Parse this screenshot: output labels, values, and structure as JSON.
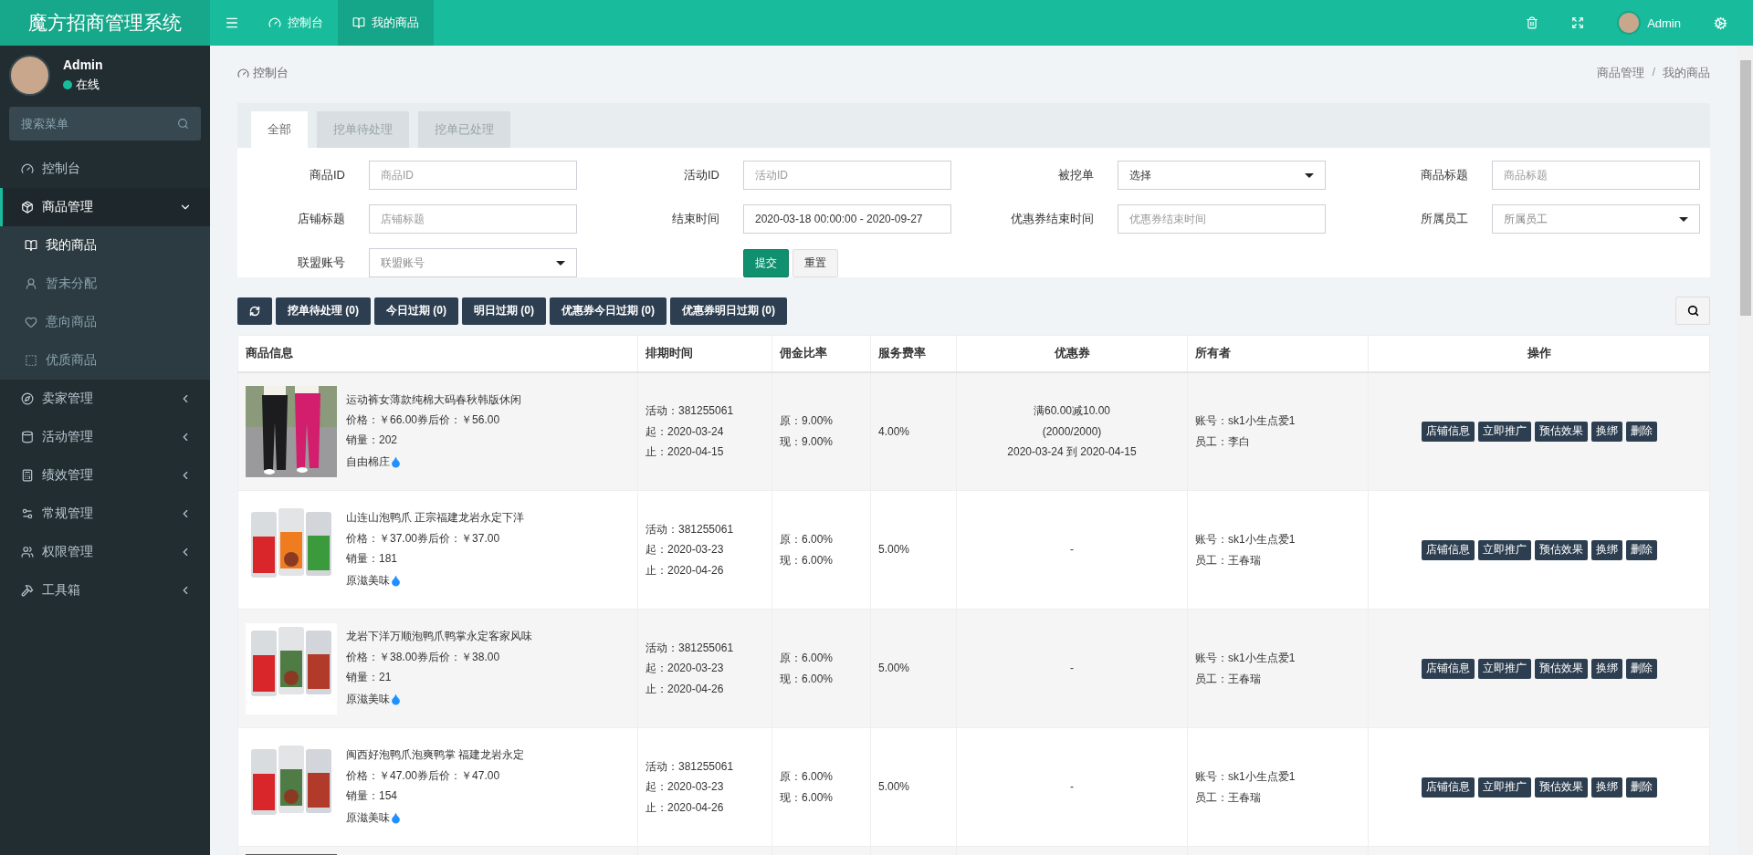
{
  "app": {
    "title": "魔方招商管理系统"
  },
  "topbar": {
    "tabs": [
      {
        "label": "控制台",
        "selected": false
      },
      {
        "label": "我的商品",
        "selected": true
      }
    ],
    "user": "Admin"
  },
  "sidebar": {
    "user": {
      "name": "Admin",
      "status": "在线"
    },
    "search": {
      "placeholder": "搜索菜单"
    },
    "items": [
      {
        "label": "控制台",
        "kind": "link"
      },
      {
        "label": "商品管理",
        "kind": "group",
        "expanded": true,
        "children": [
          {
            "label": "我的商品",
            "selected": true
          },
          {
            "label": "暂未分配",
            "selected": false
          },
          {
            "label": "意向商品",
            "selected": false
          },
          {
            "label": "优质商品",
            "selected": false
          }
        ]
      },
      {
        "label": "卖家管理",
        "kind": "group",
        "expanded": false
      },
      {
        "label": "活动管理",
        "kind": "group",
        "expanded": false
      },
      {
        "label": "绩效管理",
        "kind": "group",
        "expanded": false
      },
      {
        "label": "常规管理",
        "kind": "group",
        "expanded": false
      },
      {
        "label": "权限管理",
        "kind": "group",
        "expanded": false
      },
      {
        "label": "工具箱",
        "kind": "group",
        "expanded": false
      }
    ]
  },
  "breadcrumb": {
    "page": "控制台",
    "trail": [
      "商品管理",
      "我的商品"
    ],
    "separator": "/"
  },
  "tabs": [
    {
      "label": "全部",
      "selected": true
    },
    {
      "label": "挖单待处理",
      "selected": false
    },
    {
      "label": "挖单已处理",
      "selected": false
    }
  ],
  "filters": [
    {
      "label": "商品ID",
      "kind": "text",
      "placeholder": "商品ID"
    },
    {
      "label": "活动ID",
      "kind": "text",
      "placeholder": "活动ID"
    },
    {
      "label": "被挖单",
      "kind": "select",
      "value": "选择"
    },
    {
      "label": "商品标题",
      "kind": "text",
      "placeholder": "商品标题"
    },
    {
      "label": "店铺标题",
      "kind": "text",
      "placeholder": "店铺标题"
    },
    {
      "label": "结束时间",
      "kind": "text",
      "value": "2020-03-18 00:00:00 - 2020-09-27"
    },
    {
      "label": "优惠券结束时间",
      "kind": "text",
      "placeholder": "优惠券结束时间"
    },
    {
      "label": "所属员工",
      "kind": "select",
      "placeholder": "所属员工"
    },
    {
      "label": "联盟账号",
      "kind": "select",
      "placeholder": "联盟账号"
    }
  ],
  "form_buttons": [
    {
      "label": "提交",
      "kind": "primary"
    },
    {
      "label": "重置",
      "kind": "default"
    }
  ],
  "toolbar": {
    "buttons": [
      "挖单待处理 (0)",
      "今日过期 (0)",
      "明日过期 (0)",
      "优惠券今日过期 (0)",
      "优惠券明日过期 (0)"
    ]
  },
  "table": {
    "columns": [
      "商品信息",
      "排期时间",
      "佣金比率",
      "服务费率",
      "优惠券",
      "所有者",
      "操作"
    ],
    "rows": [
      {
        "product": {
          "title": "运动裤女薄款纯棉大码春秋韩版休闲",
          "price": "价格：￥66.00券后价：￥56.00",
          "sales": "销量：202",
          "shop": "自由棉庄"
        },
        "schedule": [
          "活动：381255061",
          "起：2020-03-24",
          "止：2020-04-15"
        ],
        "commission": [
          "原：9.00%",
          "现：9.00%"
        ],
        "service": "4.00%",
        "coupon": [
          "满60.00减10.00",
          "(2000/2000)",
          "2020-03-24 到 2020-04-15"
        ],
        "owner": [
          "账号：sk1小生点爱1",
          "员工：李白"
        ],
        "actions": [
          "店铺信息",
          "立即推广",
          "预估效果",
          "换绑",
          "删除"
        ]
      },
      {
        "product": {
          "title": "山连山泡鸭爪 正宗福建龙岩永定下洋",
          "price": "价格：￥37.00券后价：￥37.00",
          "sales": "销量：181",
          "shop": "原滋美味"
        },
        "schedule": [
          "活动：381255061",
          "起：2020-03-23",
          "止：2020-04-26"
        ],
        "commission": [
          "原：6.00%",
          "现：6.00%"
        ],
        "service": "5.00%",
        "coupon": [
          "-"
        ],
        "owner": [
          "账号：sk1小生点爱1",
          "员工：王春瑞"
        ],
        "actions": [
          "店铺信息",
          "立即推广",
          "预估效果",
          "换绑",
          "删除"
        ]
      },
      {
        "product": {
          "title": "龙岩下洋万顺泡鸭爪鸭掌永定客家风味",
          "price": "价格：￥38.00券后价：￥38.00",
          "sales": "销量：21",
          "shop": "原滋美味"
        },
        "schedule": [
          "活动：381255061",
          "起：2020-03-23",
          "止：2020-04-26"
        ],
        "commission": [
          "原：6.00%",
          "现：6.00%"
        ],
        "service": "5.00%",
        "coupon": [
          "-"
        ],
        "owner": [
          "账号：sk1小生点爱1",
          "员工：王春瑞"
        ],
        "actions": [
          "店铺信息",
          "立即推广",
          "预估效果",
          "换绑",
          "删除"
        ]
      },
      {
        "product": {
          "title": "闽西好泡鸭爪泡爽鸭掌 福建龙岩永定",
          "price": "价格：￥47.00券后价：￥47.00",
          "sales": "销量：154",
          "shop": "原滋美味"
        },
        "schedule": [
          "活动：381255061",
          "起：2020-03-23",
          "止：2020-04-26"
        ],
        "commission": [
          "原：6.00%",
          "现：6.00%"
        ],
        "service": "5.00%",
        "coupon": [
          "-"
        ],
        "owner": [
          "账号：sk1小生点爱1",
          "员工：王春瑞"
        ],
        "actions": [
          "店铺信息",
          "立即推广",
          "预估效果",
          "换绑",
          "删除"
        ]
      }
    ],
    "partial_row": {
      "kind": "picture"
    }
  }
}
